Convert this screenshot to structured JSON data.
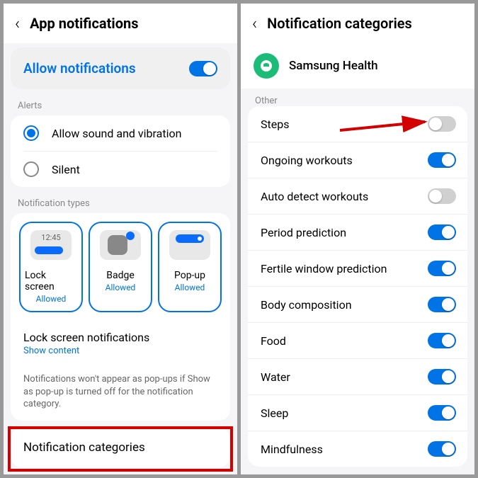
{
  "left": {
    "header_title": "App notifications",
    "allow_label": "Allow notifications",
    "allow_on": true,
    "alerts_label": "Alerts",
    "alerts": [
      {
        "label": "Allow sound and vibration",
        "selected": true
      },
      {
        "label": "Silent",
        "selected": false
      }
    ],
    "types_label": "Notification types",
    "types": [
      {
        "label": "Lock screen",
        "status": "Allowed"
      },
      {
        "label": "Badge",
        "status": "Allowed"
      },
      {
        "label": "Pop-up",
        "status": "Allowed"
      }
    ],
    "lock_screen_title": "Lock screen notifications",
    "lock_screen_sub": "Show content",
    "hint": "Notifications won't appear as pop-ups if Show as pop-up is turned off for the notification category.",
    "notif_cat": "Notification categories",
    "lock_time": "12:45"
  },
  "right": {
    "header_title": "Notification categories",
    "app_name": "Samsung Health",
    "section_label": "Other",
    "categories": [
      {
        "label": "Steps",
        "on": false,
        "arrow": true
      },
      {
        "label": "Ongoing workouts",
        "on": true
      },
      {
        "label": "Auto detect workouts",
        "on": false
      },
      {
        "label": "Period prediction",
        "on": true
      },
      {
        "label": "Fertile window prediction",
        "on": true
      },
      {
        "label": "Body composition",
        "on": true
      },
      {
        "label": "Food",
        "on": true
      },
      {
        "label": "Water",
        "on": true
      },
      {
        "label": "Sleep",
        "on": true
      },
      {
        "label": "Mindfulness",
        "on": true
      }
    ]
  }
}
